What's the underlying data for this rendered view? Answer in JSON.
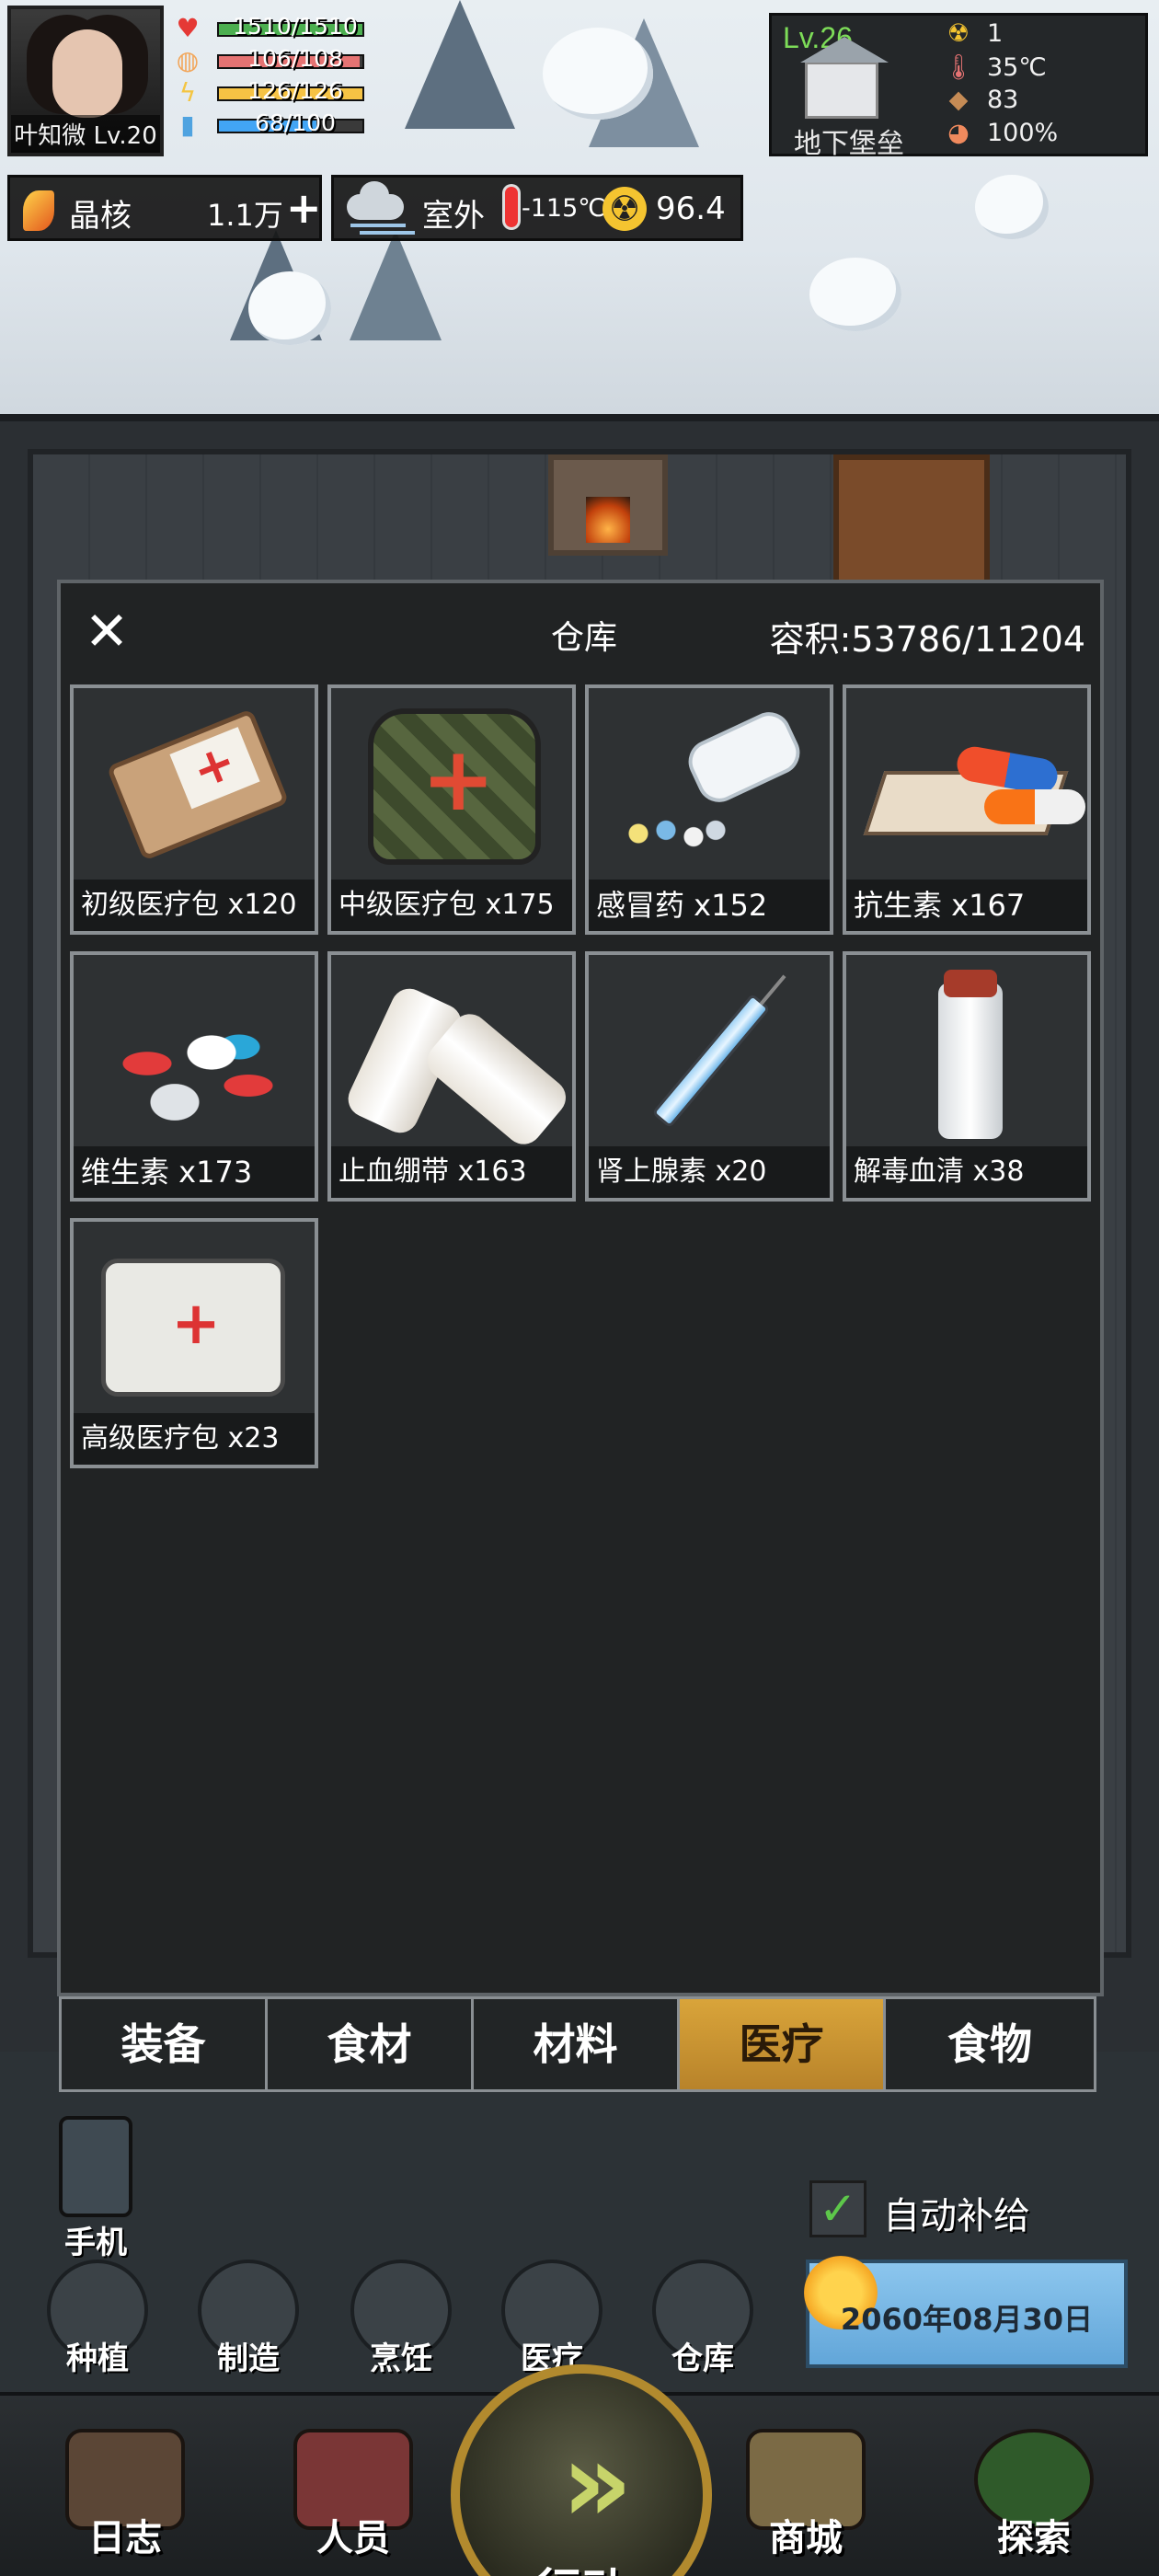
{
  "player": {
    "name_level": "叶知微 Lv.20",
    "stats": [
      {
        "icon": "heart-icon",
        "color": "#e53935",
        "text": "1510/1510",
        "fill": 1.0,
        "bar": "#4caf50"
      },
      {
        "icon": "stomach-icon",
        "color": "#f2a65a",
        "text": "106/108",
        "fill": 0.98,
        "bar": "#e57373"
      },
      {
        "icon": "energy-icon",
        "color": "#f4c542",
        "text": "126/126",
        "fill": 1.0,
        "bar": "#f6c344"
      },
      {
        "icon": "water-icon",
        "color": "#4fa3e0",
        "text": "68/100",
        "fill": 0.68,
        "bar": "#42a5f5"
      }
    ]
  },
  "base": {
    "level": "Lv.26",
    "name": "地下堡垒",
    "stats": [
      {
        "icon": "radiation-icon",
        "glyph": "☢",
        "text": "1"
      },
      {
        "icon": "thermometer-icon",
        "glyph": "🌡",
        "text": "35℃"
      },
      {
        "icon": "food-icon",
        "glyph": "◆",
        "text": "83"
      },
      {
        "icon": "pie-icon",
        "glyph": "◕",
        "text": "100%"
      }
    ]
  },
  "resources": {
    "crystal_label": "晶核",
    "crystal_value": "1.1万",
    "crystal_add": "+",
    "weather_label": "室外",
    "outside_temp": "-115℃",
    "radiation": "96.4"
  },
  "warehouse": {
    "close": "✕",
    "title": "仓库",
    "capacity": "容积:53786/11204",
    "items": [
      {
        "label": "初级医疗包 x120"
      },
      {
        "label": "中级医疗包 x175"
      },
      {
        "label": "感冒药 x152"
      },
      {
        "label": "抗生素 x167"
      },
      {
        "label": "维生素 x173"
      },
      {
        "label": "止血绷带 x163"
      },
      {
        "label": "肾上腺素 x20"
      },
      {
        "label": "解毒血清 x38"
      },
      {
        "label": "高级医疗包 x23"
      }
    ],
    "tabs": [
      "装备",
      "食材",
      "材料",
      "医疗",
      "食物"
    ],
    "active_tab": "医疗"
  },
  "bottom": {
    "phone": "手机",
    "auto_supply_check": "✓",
    "auto_supply": "自动补给",
    "date": "2060年08月30日",
    "shortcuts": [
      "种植",
      "制造",
      "烹饪",
      "医疗",
      "仓库"
    ],
    "nav": [
      "日志",
      "人员",
      "行动",
      "商城",
      "探索"
    ],
    "go_arrows": "»"
  }
}
